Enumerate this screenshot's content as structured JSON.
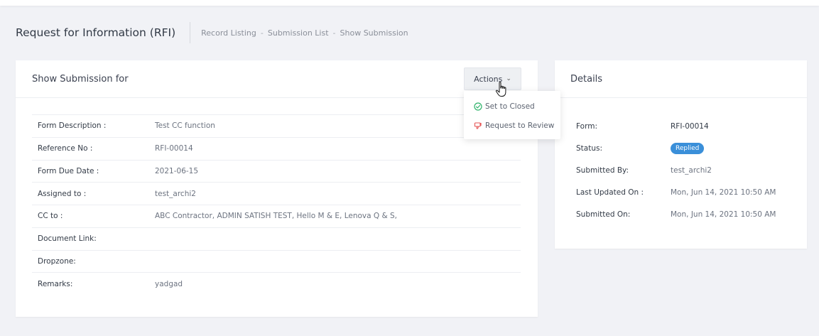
{
  "header": {
    "title": "Request for Information (RFI)",
    "breadcrumb": [
      "Record Listing",
      "Submission List",
      "Show Submission"
    ],
    "separator": "-"
  },
  "main_card": {
    "title": "Show Submission for",
    "actions_label": "Actions",
    "dropdown": [
      {
        "label": "Set to Closed",
        "icon": "check-circle-icon",
        "color": "#2fb36b"
      },
      {
        "label": "Request to Review",
        "icon": "thumbs-down-icon",
        "color": "#e55353"
      }
    ],
    "rows": [
      {
        "label": "Form Description :",
        "value": "Test CC function"
      },
      {
        "label": "Reference No :",
        "value": "RFI-00014"
      },
      {
        "label": "Form Due Date :",
        "value": "2021-06-15"
      },
      {
        "label": "Assigned to :",
        "value": "test_archi2"
      },
      {
        "label": "CC to :",
        "value": "ABC Contractor, ADMIN SATISH TEST, Hello M & E, Lenova Q & S,"
      },
      {
        "label": "Document Link:",
        "value": ""
      },
      {
        "label": "Dropzone:",
        "value": ""
      },
      {
        "label": "Remarks:",
        "value": "yadgad"
      }
    ]
  },
  "details_card": {
    "title": "Details",
    "rows": [
      {
        "label": "Form:",
        "value": "RFI-00014"
      },
      {
        "label": "Status:",
        "value": "Replied"
      },
      {
        "label": "Submitted By:",
        "value": "test_archi2"
      },
      {
        "label": "Last Updated On :",
        "value": "Mon, Jun 14, 2021 10:50 AM"
      },
      {
        "label": "Submitted On:",
        "value": "Mon, Jun 14, 2021 10:50 AM"
      }
    ],
    "status_color": "#3a8fd9"
  }
}
